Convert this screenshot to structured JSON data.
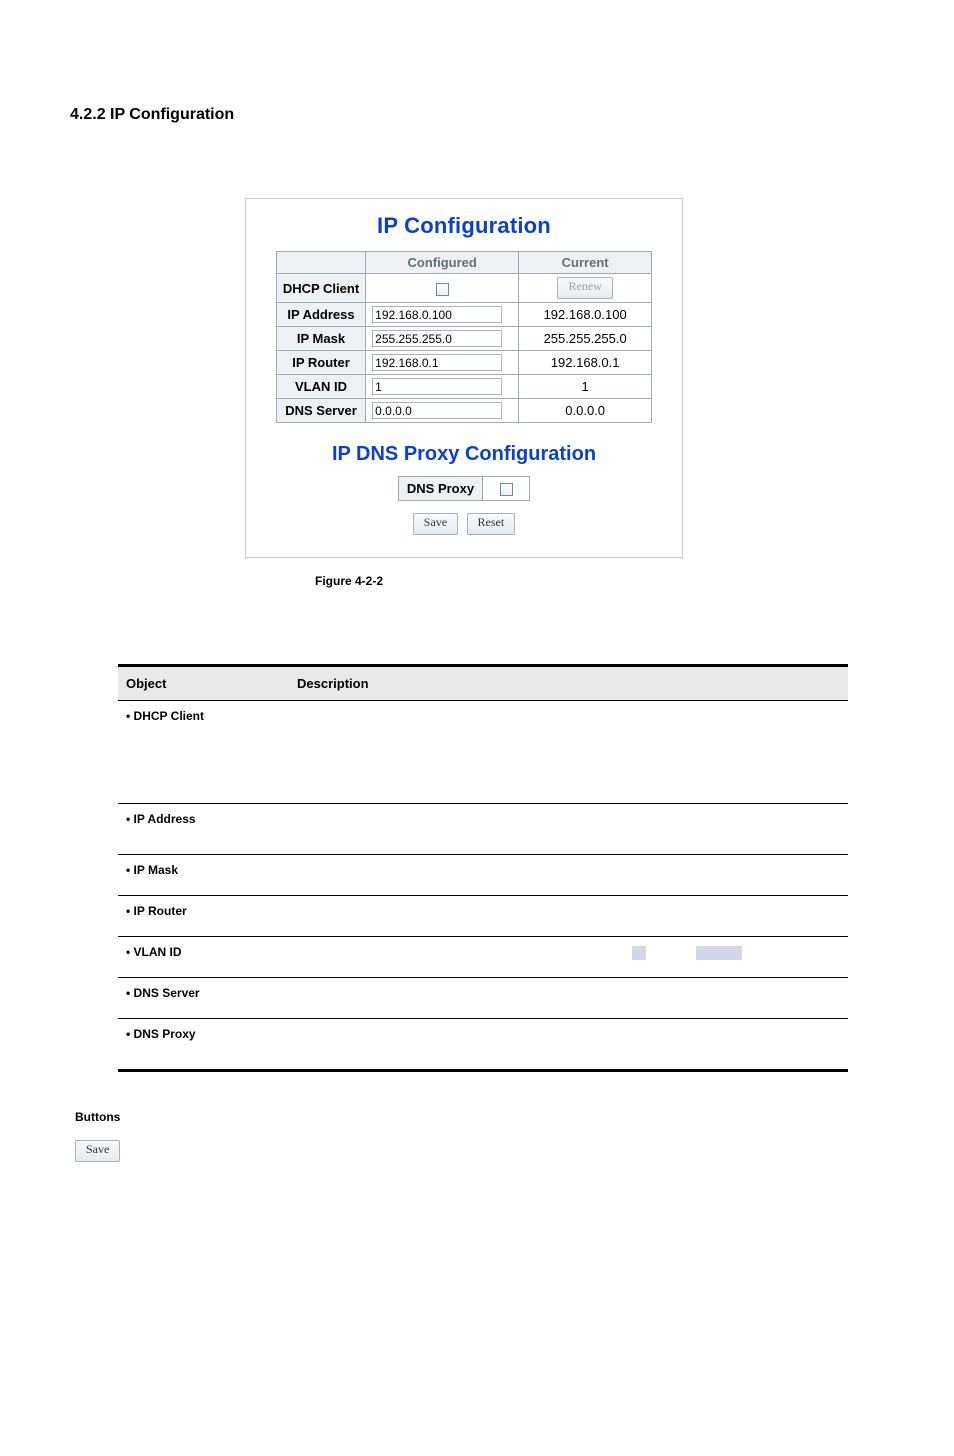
{
  "section_title": "4.2.2 IP Configuration",
  "panel": {
    "title": "IP Configuration",
    "columns": {
      "configured": "Configured",
      "current": "Current"
    },
    "rows": {
      "dhcp": {
        "label": "DHCP Client",
        "current_btn": "Renew"
      },
      "ip": {
        "label": "IP Address",
        "configured": "192.168.0.100",
        "current": "192.168.0.100"
      },
      "mask": {
        "label": "IP Mask",
        "configured": "255.255.255.0",
        "current": "255.255.255.0"
      },
      "router": {
        "label": "IP Router",
        "configured": "192.168.0.1",
        "current": "192.168.0.1"
      },
      "vlan": {
        "label": "VLAN ID",
        "configured": "1",
        "current": "1"
      },
      "dns": {
        "label": "DNS Server",
        "configured": "0.0.0.0",
        "current": "0.0.0.0"
      }
    },
    "title2": "IP DNS Proxy Configuration",
    "dns_proxy_label": "DNS Proxy",
    "save_btn": "Save",
    "reset_btn": "Reset"
  },
  "figure_caption": "Figure 4-2-2",
  "desc_table": {
    "headers": {
      "object": "Object",
      "description": "Description"
    },
    "rows": [
      {
        "object": "DHCP Client",
        "class": "tall"
      },
      {
        "object": "IP Address",
        "class": "med"
      },
      {
        "object": "IP Mask",
        "class": "short"
      },
      {
        "object": "IP Router",
        "class": "short"
      },
      {
        "object": "VLAN ID",
        "class": "short",
        "bars": true
      },
      {
        "object": "DNS Server",
        "class": "short"
      },
      {
        "object": "DNS Proxy",
        "class": "med"
      }
    ]
  },
  "buttons_label": "Buttons",
  "bottom_save_btn": "Save"
}
